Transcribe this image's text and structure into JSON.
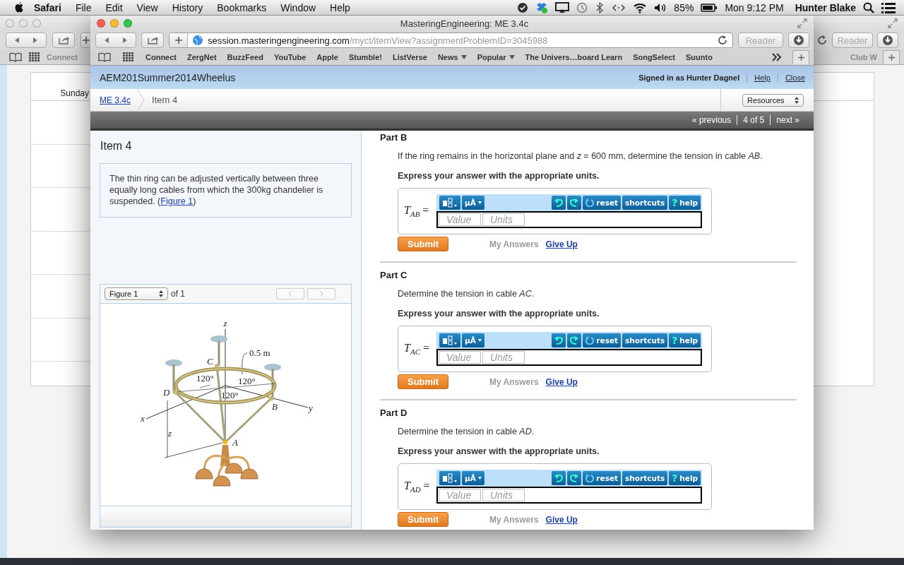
{
  "menubar": {
    "app": "Safari",
    "menus": [
      "File",
      "Edit",
      "View",
      "History",
      "Bookmarks",
      "Window",
      "Help"
    ],
    "battery": "85%",
    "clock": "Mon 9:12 PM",
    "user": "Hunter Blake"
  },
  "back_window": {
    "bookmark": "Connect",
    "bookmark_right": "Club W",
    "reader": "Reader",
    "calendar_columns": [
      "Sunday"
    ]
  },
  "window": {
    "title": "MasteringEngineering: ME 3.4c",
    "url_host": "session.masteringengineering.com",
    "url_path": "/myct/itemView?assignmentProblemID=3045988",
    "reader": "Reader",
    "bookmarks": [
      {
        "label": "Connect",
        "menu": false
      },
      {
        "label": "ZergNet",
        "menu": false
      },
      {
        "label": "BuzzFeed",
        "menu": false
      },
      {
        "label": "YouTube",
        "menu": false
      },
      {
        "label": "Apple",
        "menu": false
      },
      {
        "label": "Stumble!",
        "menu": false
      },
      {
        "label": "ListVerse",
        "menu": false
      },
      {
        "label": "News",
        "menu": true
      },
      {
        "label": "Popular",
        "menu": true
      },
      {
        "label": "The Univers…board Learn",
        "menu": false
      },
      {
        "label": "SongSelect",
        "menu": false
      },
      {
        "label": "Suunto",
        "menu": false
      }
    ]
  },
  "header": {
    "course": "AEM201Summer2014Wheelus",
    "signed_in": "Signed in as Hunter Dagnel",
    "links": [
      "Help",
      "Close"
    ]
  },
  "breadcrumb": {
    "link": "ME 3.4c",
    "current": "Item 4",
    "resources": "Resources"
  },
  "pager": {
    "previous": "« previous",
    "position": "4 of 5",
    "next": "next »"
  },
  "item": {
    "title": "Item 4",
    "text_before": "The thin ring can be adjusted vertically between three equally long cables from which the 300kg chandelier is suspended. (",
    "link": "Figure 1",
    "text_after": ")"
  },
  "figure": {
    "select": "Figure 1",
    "of": "of 1",
    "labels": [
      "z",
      "0.5 m",
      "C",
      "120°",
      "120°",
      "120°",
      "D",
      "B",
      "y",
      "x",
      "z",
      "A"
    ]
  },
  "parts": [
    {
      "title": "Part B",
      "question": "If the ring remains in the horizontal plane and *z* = 600 mm, determine the tension in cable *AB*.",
      "instruction": "Express your answer with the appropriate units.",
      "symbol": "*T*$_{AB}$ =",
      "units_button": "μÅ",
      "reset": "reset",
      "shortcuts": "shortcuts",
      "help_mark": "?",
      "help": "help",
      "value_placeholder": "Value",
      "units_placeholder": "Units",
      "submit": "Submit",
      "my_answers": "My Answers",
      "give_up": "Give Up"
    },
    {
      "title": "Part C",
      "question": "Determine the tension in cable *AC*.",
      "instruction": "Express your answer with the appropriate units.",
      "symbol": "*T*$_{AC}$ =",
      "units_button": "μÅ",
      "reset": "reset",
      "shortcuts": "shortcuts",
      "help_mark": "?",
      "help": "help",
      "value_placeholder": "Value",
      "units_placeholder": "Units",
      "submit": "Submit",
      "my_answers": "My Answers",
      "give_up": "Give Up"
    },
    {
      "title": "Part D",
      "question": "Determine the tension in cable *AD*.",
      "instruction": "Express your answer with the appropriate units.",
      "symbol": "*T*$_{AD}$ =",
      "units_button": "μÅ",
      "reset": "reset",
      "shortcuts": "shortcuts",
      "help_mark": "?",
      "help": "help",
      "value_placeholder": "Value",
      "units_placeholder": "Units",
      "submit": "Submit",
      "my_answers": "My Answers",
      "give_up": "Give Up"
    }
  ]
}
